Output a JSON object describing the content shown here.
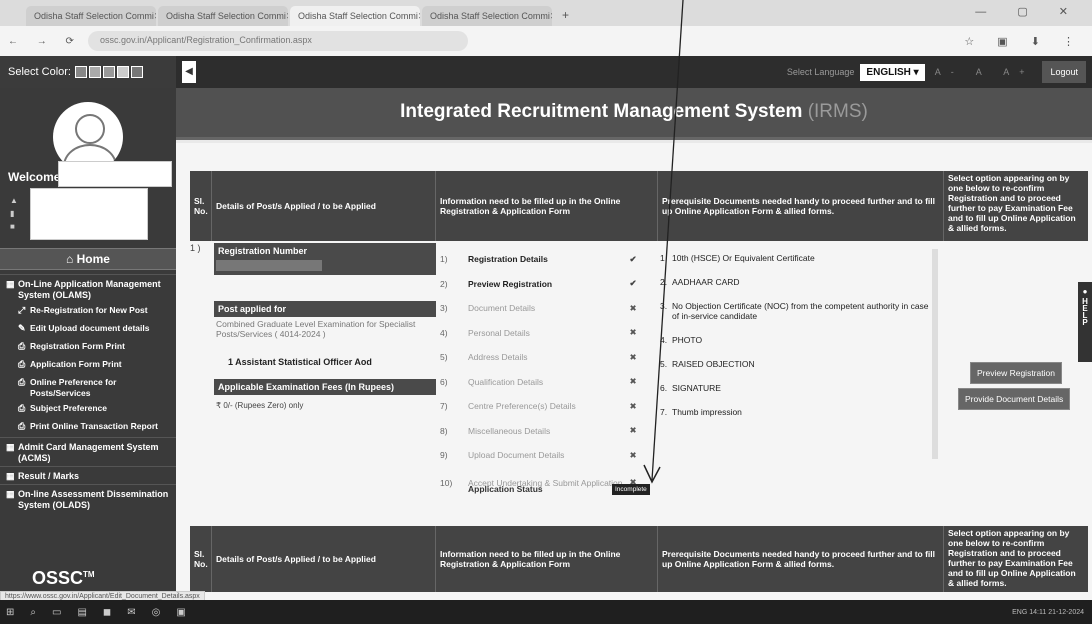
{
  "browser": {
    "tabs": [
      {
        "label": "Odisha Staff Selection Commi",
        "active": false
      },
      {
        "label": "Odisha Staff Selection Commi",
        "active": false
      },
      {
        "label": "Odisha Staff Selection Commi",
        "active": true
      },
      {
        "label": "Odisha Staff Selection Commi",
        "active": false
      }
    ],
    "url": "ossc.gov.in/Applicant/Registration_Confirmation.aspx",
    "status_url": "https://www.ossc.gov.in/Applicant/Edit_Document_Details.aspx"
  },
  "topbar": {
    "select_color_label": "Select Color:",
    "select_language_label": "Select Language",
    "language": "ENGLISH",
    "font_size_controls": "A- A A+",
    "logout_label": "Logout"
  },
  "sidebar": {
    "welcome": "Welcome",
    "home": "Home",
    "menu": [
      {
        "label": "On-Line Application Management System (OLAMS)",
        "type": "top",
        "icon": "grid-icon"
      },
      {
        "label": "Re-Registration for New Post",
        "type": "sub",
        "icon": "expand-icon"
      },
      {
        "label": "Edit Upload document details",
        "type": "sub",
        "icon": "pencil-icon"
      },
      {
        "label": "Registration Form Print",
        "type": "sub",
        "icon": "print-icon"
      },
      {
        "label": "Application Form Print",
        "type": "sub",
        "icon": "print-icon"
      },
      {
        "label": "Online Preference for Posts/Services",
        "type": "sub",
        "icon": "print-icon"
      },
      {
        "label": "Subject Preference",
        "type": "sub",
        "icon": "print-icon"
      },
      {
        "label": "Print Online Transaction Report",
        "type": "sub",
        "icon": "print-icon"
      },
      {
        "label": "Admit Card Management System (ACMS)",
        "type": "top",
        "icon": "grid-icon"
      },
      {
        "label": "Result / Marks",
        "type": "top",
        "icon": "grid-icon"
      },
      {
        "label": "On-line Assessment Dissemination System (OLADS)",
        "type": "top",
        "icon": "grid-icon"
      }
    ],
    "brand": "OSSC",
    "brand_tm": "TM"
  },
  "header": {
    "title": "Integrated Recruitment Management System",
    "subtitle": "(IRMS)"
  },
  "table": {
    "headers": {
      "sl_no": "Sl. No.",
      "details": "Details of Post/s Applied / to be Applied",
      "info": "Information need to be filled up in the Online Registration & Application Form",
      "prereq": "Prerequisite Documents needed handy to proceed further and to fill up Online Application Form & allied forms.",
      "select": "Select option appearing on by one below to re-confirm Registration and to proceed further to pay Examination Fee and to fill up Online Application & allied forms."
    },
    "row_number": "1 )",
    "registration_number_label": "Registration Number",
    "post_applied_label": "Post applied for",
    "post_name": "Combined Graduate Level Examination for Specialist Posts/Services ( 4014-2024 )",
    "assigned_post": "1   Assistant Statistical Officer Aod",
    "fees_label": "Applicable Examination Fees (In Rupees)",
    "fees_value": "₹ 0/- (Rupees Zero) only",
    "steps": [
      {
        "n": "1)",
        "label": "Registration Details",
        "done": true
      },
      {
        "n": "2)",
        "label": "Preview Registration",
        "done": true
      },
      {
        "n": "3)",
        "label": "Document Details",
        "done": false
      },
      {
        "n": "4)",
        "label": "Personal Details",
        "done": false
      },
      {
        "n": "5)",
        "label": "Address Details",
        "done": false
      },
      {
        "n": "6)",
        "label": "Qualification Details",
        "done": false
      },
      {
        "n": "7)",
        "label": "Centre Preference(s) Details",
        "done": false
      },
      {
        "n": "8)",
        "label": "Miscellaneous Details",
        "done": false
      },
      {
        "n": "9)",
        "label": "Upload Document Details",
        "done": false
      },
      {
        "n": "10)",
        "label": "Accept Undertaking & Submit Application",
        "done": false
      }
    ],
    "mark_done": "✔",
    "mark_pending": "✖",
    "application_status_label": "Application Status",
    "application_status_value": "Incomplete",
    "documents": [
      {
        "n": "1.",
        "label": "10th (HSCE) Or Equivalent Certificate"
      },
      {
        "n": "2.",
        "label": "AADHAAR CARD"
      },
      {
        "n": "3.",
        "label": "No Objection Certificate (NOC) from the competent authority in case of in-service candidate"
      },
      {
        "n": "4.",
        "label": "PHOTO"
      },
      {
        "n": "5.",
        "label": "RAISED OBJECTION"
      },
      {
        "n": "6.",
        "label": "SIGNATURE"
      },
      {
        "n": "7.",
        "label": "Thumb impression"
      }
    ],
    "buttons": {
      "preview": "Preview Registration",
      "provide_docs": "Provide Document Details"
    }
  },
  "help_tab": "HELP",
  "taskbar": {
    "time": "14:11",
    "date": "21-12-2024",
    "lang": "ENG"
  }
}
